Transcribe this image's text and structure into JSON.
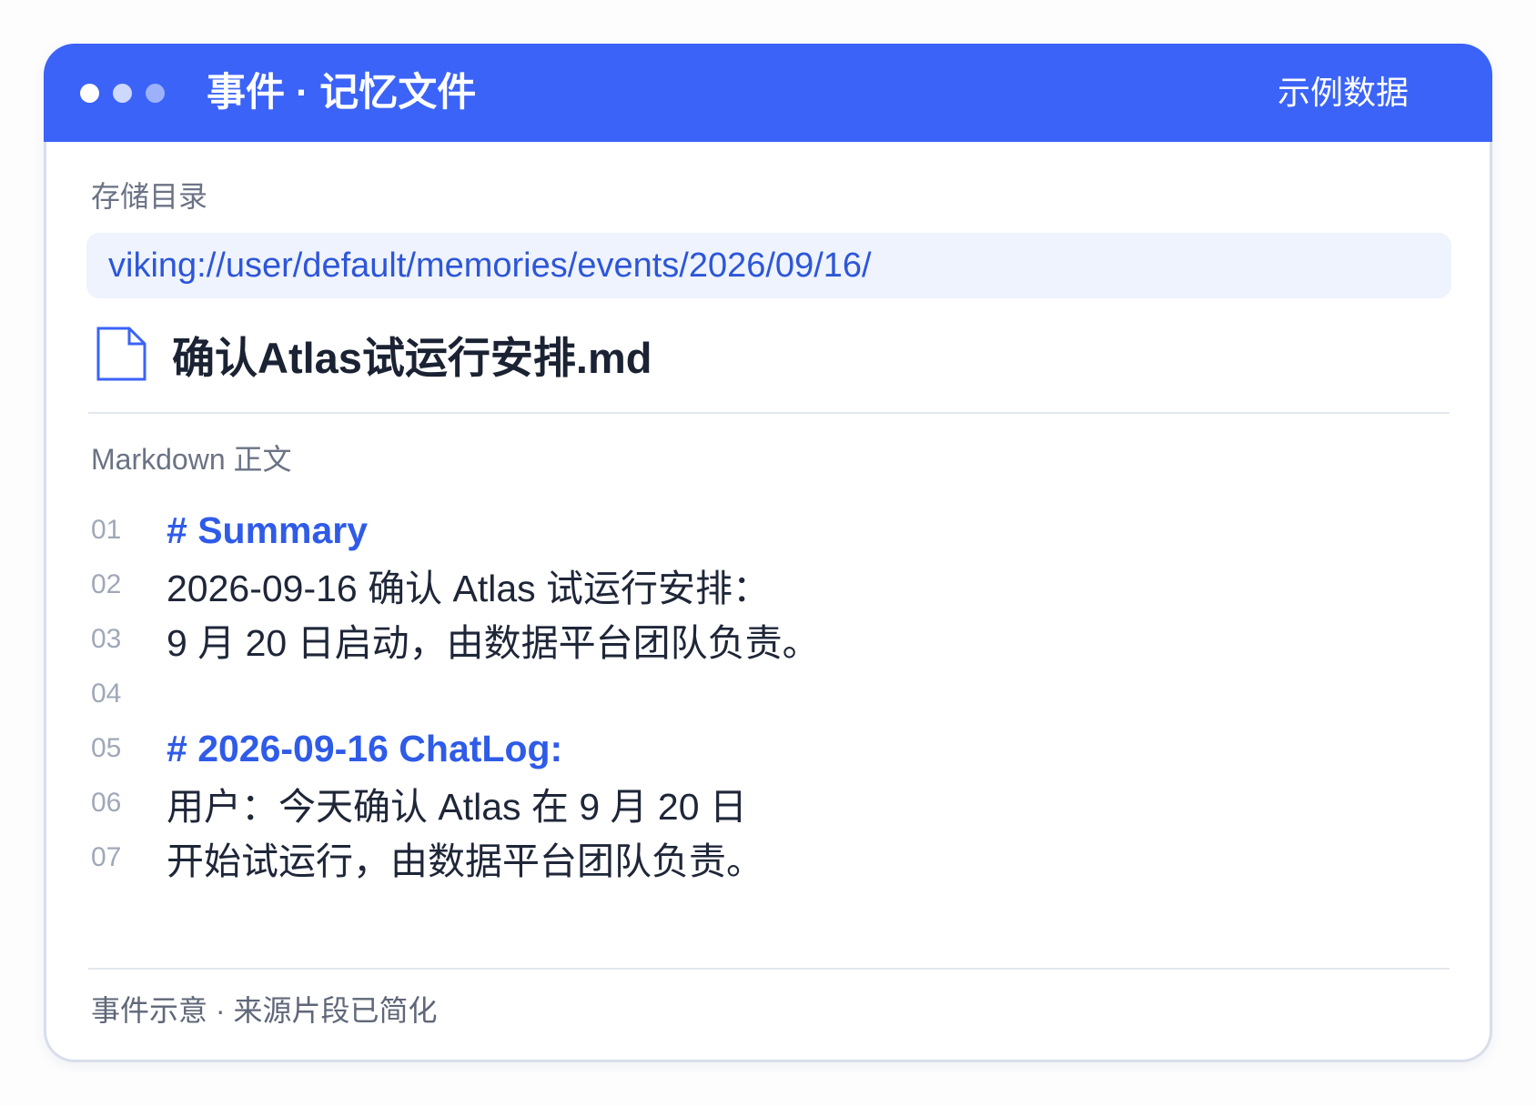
{
  "window": {
    "title": "事件 · 记忆文件",
    "badge": "示例数据"
  },
  "storage": {
    "label": "存储目录",
    "path": "viking://user/default/memories/events/2026/09/16/"
  },
  "file": {
    "icon": "file-icon",
    "name": "确认Atlas试运行安排.md"
  },
  "content": {
    "label": "Markdown 正文",
    "lines": [
      {
        "number": "01",
        "text": "# Summary"
      },
      {
        "number": "02",
        "text": "2026-09-16 确认 Atlas 试运行安排："
      },
      {
        "number": "03",
        "text": "9 月 20 日启动，由数据平台团队负责。"
      },
      {
        "number": "04",
        "text": ""
      },
      {
        "number": "05",
        "text": "# 2026-09-16 ChatLog:"
      },
      {
        "number": "06",
        "text": "用户：今天确认 Atlas 在 9 月 20 日"
      },
      {
        "number": "07",
        "text": "开始试运行，由数据平台团队负责。"
      }
    ]
  },
  "footer": {
    "text": "事件示意 · 来源片段已简化"
  },
  "colors": {
    "accent": "#3b63f7",
    "link": "#2d56d8",
    "heading": "#2f5be8"
  }
}
